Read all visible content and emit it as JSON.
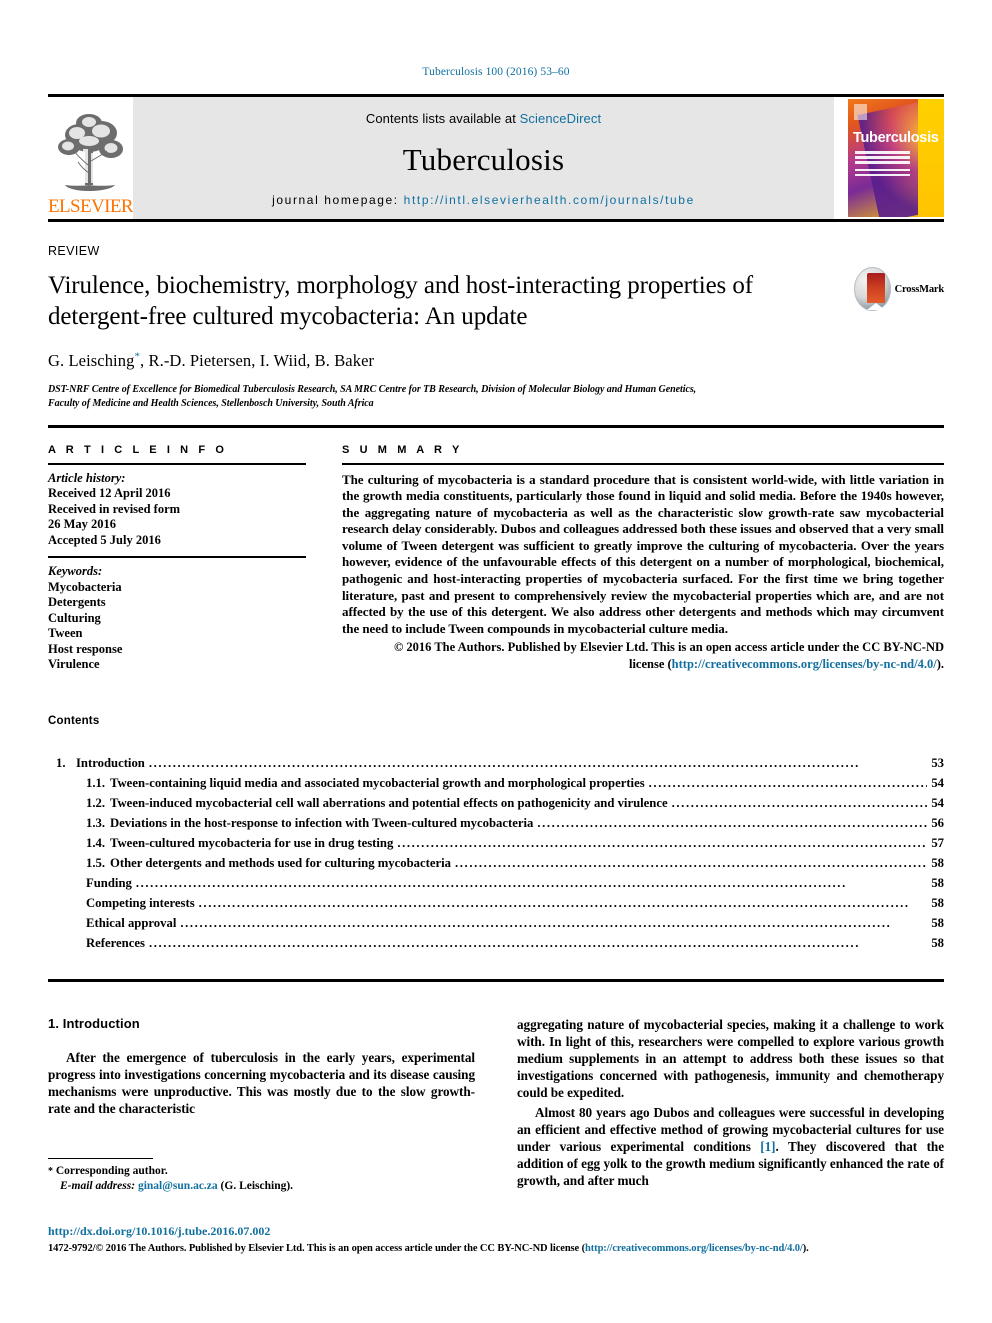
{
  "running_head": "Tuberculosis 100 (2016) 53–60",
  "masthead": {
    "publisher_logo_text": "ELSEVIER",
    "contents_prefix": "Contents lists available at ",
    "contents_link": "ScienceDirect",
    "journal_title": "Tuberculosis",
    "homepage_prefix": "journal homepage: ",
    "homepage_url": "http://intl.elsevierhealth.com/journals/tube",
    "cover_title": "Tuberculosis"
  },
  "article": {
    "type_label": "REVIEW",
    "title": "Virulence, biochemistry, morphology and host-interacting properties of detergent-free cultured mycobacteria: An update",
    "authors": "G. Leisching, R.-D. Pietersen, I. Wiid, B. Baker",
    "author_marker": "*",
    "affiliation_line1": "DST-NRF Centre of Excellence for Biomedical Tuberculosis Research, SA MRC Centre for TB Research, Division of Molecular Biology and Human Genetics,",
    "affiliation_line2": "Faculty of Medicine and Health Sciences, Stellenbosch University, South Africa",
    "crossmark_label": "CrossMark"
  },
  "article_info": {
    "heading": "A R T I C L E   I N F O",
    "history_label": "Article history:",
    "history": [
      "Received 12 April 2016",
      "Received in revised form",
      "26 May 2016",
      "Accepted 5 July 2016"
    ],
    "keywords_label": "Keywords:",
    "keywords": [
      "Mycobacteria",
      "Detergents",
      "Culturing",
      "Tween",
      "Host response",
      "Virulence"
    ]
  },
  "summary": {
    "heading": "S U M M A R Y",
    "text": "The culturing of mycobacteria is a standard procedure that is consistent world-wide, with little variation in the growth media constituents, particularly those found in liquid and solid media. Before the 1940s however, the aggregating nature of mycobacteria as well as the characteristic slow growth-rate saw mycobacterial research delay considerably. Dubos and colleagues addressed both these issues and observed that a very small volume of Tween detergent was sufficient to greatly improve the culturing of mycobacteria. Over the years however, evidence of the unfavourable effects of this detergent on a number of morphological, biochemical, pathogenic and host-interacting properties of mycobacteria surfaced. For the first time we bring together literature, past and present to comprehensively review the mycobacterial properties which are, and are not affected by the use of this detergent. We also address other detergents and methods which may circumvent the need to include Tween compounds in mycobacterial culture media.",
    "copyright_line1": "© 2016 The Authors. Published by Elsevier Ltd. This is an open access article under the CC BY-NC-ND",
    "copyright_line2_prefix": "license (",
    "copyright_license_url": "http://creativecommons.org/licenses/by-nc-nd/4.0/",
    "copyright_line2_suffix": ")."
  },
  "contents": {
    "heading": "Contents",
    "entries": [
      {
        "number": "1.",
        "level": 1,
        "label": "Introduction",
        "page": "53"
      },
      {
        "number": "1.1.",
        "level": 2,
        "label": "Tween-containing liquid media and associated mycobacterial growth and morphological properties",
        "page": "54"
      },
      {
        "number": "1.2.",
        "level": 2,
        "label": "Tween-induced mycobacterial cell wall aberrations and potential effects on pathogenicity and virulence",
        "page": "54"
      },
      {
        "number": "1.3.",
        "level": 2,
        "label": "Deviations in the host-response to infection with Tween-cultured mycobacteria",
        "page": "56"
      },
      {
        "number": "1.4.",
        "level": 2,
        "label": "Tween-cultured mycobacteria for use in drug testing",
        "page": "57"
      },
      {
        "number": "1.5.",
        "level": 2,
        "label": "Other detergents and methods used for culturing mycobacteria",
        "page": "58"
      },
      {
        "number": "",
        "level": 0,
        "label": "Funding",
        "page": "58"
      },
      {
        "number": "",
        "level": 0,
        "label": "Competing interests",
        "page": "58"
      },
      {
        "number": "",
        "level": 0,
        "label": "Ethical approval",
        "page": "58"
      },
      {
        "number": "",
        "level": 0,
        "label": "References",
        "page": "58"
      }
    ]
  },
  "body": {
    "section_heading": "1. Introduction",
    "left_paragraph": "After the emergence of tuberculosis in the early years, experimental progress into investigations concerning mycobacteria and its disease causing mechanisms were unproductive. This was mostly due to the slow growth-rate and the characteristic",
    "right_paragraph_1": "aggregating nature of mycobacterial species, making it a challenge to work with. In light of this, researchers were compelled to explore various growth medium supplements in an attempt to address both these issues so that investigations concerned with pathogenesis, immunity and chemotherapy could be expedited.",
    "right_paragraph_2a": "Almost 80 years ago Dubos and colleagues were successful in developing an efficient and effective method of growing mycobacterial cultures for use under various experimental conditions ",
    "right_paragraph_2_ref": "[1]",
    "right_paragraph_2b": ". They discovered that the addition of egg yolk to the growth medium significantly enhanced the rate of growth, and after much"
  },
  "footnote": {
    "corresponding_marker": "*",
    "corresponding_text": "Corresponding author.",
    "email_label": "E-mail address:",
    "email": "ginal@sun.ac.za",
    "email_suffix": "(G. Leisching)."
  },
  "bottom": {
    "doi": "http://dx.doi.org/10.1016/j.tube.2016.07.002",
    "issn_prefix": "1472-9792/© 2016 The Authors. Published by Elsevier Ltd. This is an open access article under the CC BY-NC-ND license (",
    "issn_license_url": "http://creativecommons.org/licenses/by-nc-nd/4.0/",
    "issn_suffix": ")."
  },
  "colors": {
    "link": "#1170a0",
    "elsevier_orange": "#ff7300",
    "masthead_bg": "#e6e6e6"
  }
}
